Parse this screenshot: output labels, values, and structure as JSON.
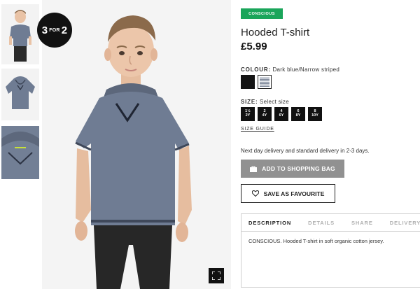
{
  "promo": {
    "big1": "3",
    "small": "FOR",
    "big2": "2"
  },
  "product": {
    "tag": "CONSCIOUS",
    "title": "Hooded T-shirt",
    "price": "£5.99",
    "colour_label": "COLOUR:",
    "colour_value": "Dark blue/Narrow striped",
    "swatches": [
      {
        "name": "Black",
        "color": "#141414"
      },
      {
        "name": "Dark blue/Narrow striped",
        "color": "#7a8496"
      }
    ],
    "size_label": "SIZE:",
    "size_placeholder": "Select size",
    "sizes": [
      {
        "line1": "1½",
        "line2": "2Y"
      },
      {
        "line1": "2",
        "line2": "4Y"
      },
      {
        "line1": "4",
        "line2": "6Y"
      },
      {
        "line1": "6",
        "line2": "8Y"
      },
      {
        "line1": "8",
        "line2": "10Y"
      }
    ],
    "size_guide": "SIZE GUIDE",
    "delivery": "Next day delivery and standard delivery in 2-3 days.",
    "add_to_bag": "ADD TO SHOPPING BAG",
    "save_favourite": "SAVE AS FAVOURITE",
    "tabs": [
      "DESCRIPTION",
      "DETAILS",
      "SHARE",
      "DELIVERY AN"
    ],
    "description": "CONSCIOUS. Hooded T-shirt in soft organic cotton jersey."
  },
  "colors": {
    "tag_green": "#1aa55a",
    "button_grey": "#919191",
    "shirt_blue": "#6f7c93",
    "dark": "#111111"
  }
}
